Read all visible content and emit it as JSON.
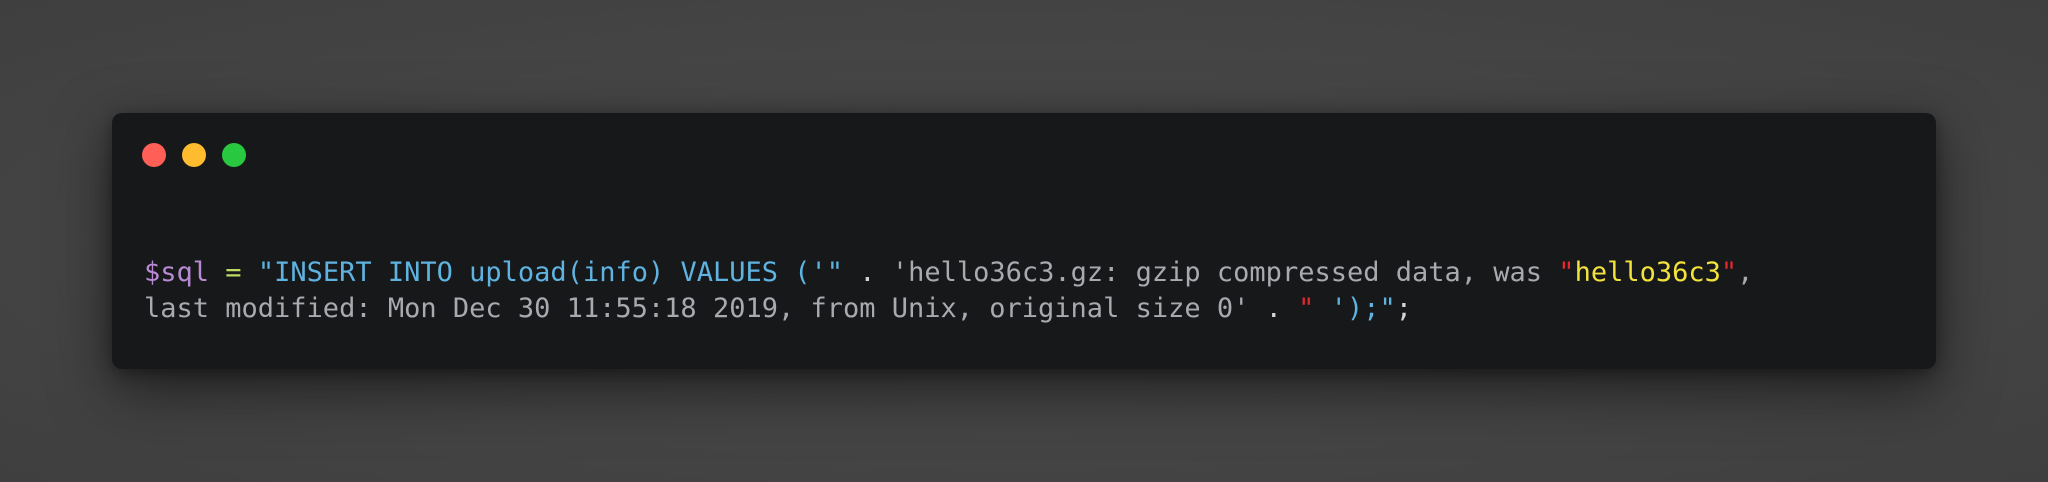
{
  "colors": {
    "background": "#454545",
    "window": "#17181a",
    "close": "#ff5f57",
    "minimize": "#febc2e",
    "maximize": "#28c840",
    "variable": "#b98ad4",
    "operator": "#bddb5e",
    "string": "#5fb3e0",
    "plain": "#a8aab0",
    "quote_red": "#e0282e",
    "highlight": "#f2e33c",
    "punct": "#d4d4d4"
  },
  "window_controls": [
    {
      "name": "close-button",
      "color": "#ff5f57"
    },
    {
      "name": "minimize-button",
      "color": "#febc2e"
    },
    {
      "name": "maximize-button",
      "color": "#28c840"
    }
  ],
  "code_lines": [
    [
      {
        "text": "$sql",
        "color": "#b98ad4"
      },
      {
        "text": " ",
        "color": "#a8aab0"
      },
      {
        "text": "=",
        "color": "#bddb5e"
      },
      {
        "text": " ",
        "color": "#a8aab0"
      },
      {
        "text": "\"INSERT INTO upload(info) VALUES ('\"",
        "color": "#5fb3e0"
      },
      {
        "text": " . ",
        "color": "#d4d4d4"
      },
      {
        "text": "'hello36c3.gz: gzip compressed data, was ",
        "color": "#a8aab0"
      },
      {
        "text": "\"",
        "color": "#e0282e"
      },
      {
        "text": "hello36c3",
        "color": "#f2e33c"
      },
      {
        "text": "\"",
        "color": "#e0282e"
      },
      {
        "text": ",",
        "color": "#a8aab0"
      }
    ],
    [
      {
        "text": "last modified: Mon Dec 30 11:55:18 2019, from Unix, original size 0'",
        "color": "#a8aab0"
      },
      {
        "text": " . ",
        "color": "#d4d4d4"
      },
      {
        "text": "\"",
        "color": "#e0282e"
      },
      {
        "text": " ');\"",
        "color": "#5fb3e0"
      },
      {
        "text": ";",
        "color": "#d4d4d4"
      }
    ]
  ]
}
